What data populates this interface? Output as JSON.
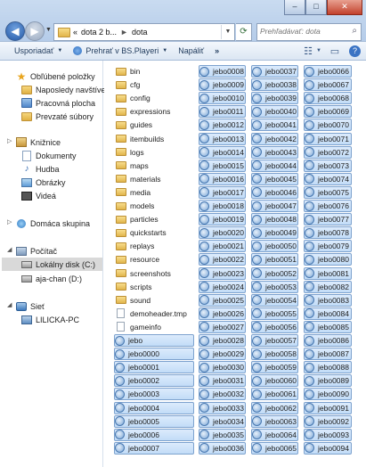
{
  "window": {
    "minimize": "–",
    "maximize": "□",
    "close": "✕"
  },
  "address": {
    "overflow": "«",
    "path_parent": "dota 2 b...",
    "separator": "►",
    "path_current": "dota"
  },
  "search": {
    "placeholder": "Prehľadávať: dota"
  },
  "toolbar": {
    "organize": "Usporiadať",
    "play": "Prehrať v BS.Playeri",
    "burn": "Napáliť",
    "more": "»"
  },
  "nav": {
    "favorites": "Obľúbené položky",
    "recent": "Naposledy navštívené",
    "desktop": "Pracovná plocha",
    "downloads": "Prevzaté súbory",
    "libraries": "Knižnice",
    "documents": "Dokumenty",
    "music": "Hudba",
    "pictures": "Obrázky",
    "videos": "Videá",
    "homegroup": "Domáca skupina",
    "computer": "Počítač",
    "local_disk": "Lokálny disk (C:)",
    "second_disk": "aja-chan (D:)",
    "network": "Sieť",
    "network_pc": "LILICKA-PC"
  },
  "files": {
    "col1": [
      {
        "name": "bin",
        "type": "folder"
      },
      {
        "name": "cfg",
        "type": "folder"
      },
      {
        "name": "config",
        "type": "folder"
      },
      {
        "name": "expressions",
        "type": "folder"
      },
      {
        "name": "guides",
        "type": "folder"
      },
      {
        "name": "itembuilds",
        "type": "folder"
      },
      {
        "name": "logs",
        "type": "folder"
      },
      {
        "name": "maps",
        "type": "folder"
      },
      {
        "name": "materials",
        "type": "folder"
      },
      {
        "name": "media",
        "type": "folder"
      },
      {
        "name": "models",
        "type": "folder"
      },
      {
        "name": "particles",
        "type": "folder"
      },
      {
        "name": "quickstarts",
        "type": "folder"
      },
      {
        "name": "replays",
        "type": "folder"
      },
      {
        "name": "resource",
        "type": "folder"
      },
      {
        "name": "screenshots",
        "type": "folder"
      },
      {
        "name": "scripts",
        "type": "folder"
      },
      {
        "name": "sound",
        "type": "folder"
      },
      {
        "name": "demoheader.tmp",
        "type": "file"
      },
      {
        "name": "gameinfo",
        "type": "file"
      },
      {
        "name": "jebo",
        "type": "dem"
      },
      {
        "name": "jebo0000",
        "type": "dem"
      },
      {
        "name": "jebo0001",
        "type": "dem"
      },
      {
        "name": "jebo0002",
        "type": "dem"
      },
      {
        "name": "jebo0003",
        "type": "dem"
      },
      {
        "name": "jebo0004",
        "type": "dem"
      },
      {
        "name": "jebo0005",
        "type": "dem"
      },
      {
        "name": "jebo0006",
        "type": "dem"
      },
      {
        "name": "jebo0007",
        "type": "dem"
      }
    ],
    "col2": [
      "jebo0008",
      "jebo0009",
      "jebo0010",
      "jebo0011",
      "jebo0012",
      "jebo0013",
      "jebo0014",
      "jebo0015",
      "jebo0016",
      "jebo0017",
      "jebo0018",
      "jebo0019",
      "jebo0020",
      "jebo0021",
      "jebo0022",
      "jebo0023",
      "jebo0024",
      "jebo0025",
      "jebo0026",
      "jebo0027",
      "jebo0028",
      "jebo0029",
      "jebo0030",
      "jebo0031",
      "jebo0032",
      "jebo0033",
      "jebo0034",
      "jebo0035",
      "jebo0036"
    ],
    "col3": [
      "jebo0037",
      "jebo0038",
      "jebo0039",
      "jebo0040",
      "jebo0041",
      "jebo0042",
      "jebo0043",
      "jebo0044",
      "jebo0045",
      "jebo0046",
      "jebo0047",
      "jebo0048",
      "jebo0049",
      "jebo0050",
      "jebo0051",
      "jebo0052",
      "jebo0053",
      "jebo0054",
      "jebo0055",
      "jebo0056",
      "jebo0057",
      "jebo0058",
      "jebo0059",
      "jebo0060",
      "jebo0061",
      "jebo0062",
      "jebo0063",
      "jebo0064",
      "jebo0065"
    ],
    "col4": [
      "jebo0066",
      "jebo0067",
      "jebo0068",
      "jebo0069",
      "jebo0070",
      "jebo0071",
      "jebo0072",
      "jebo0073",
      "jebo0074",
      "jebo0075",
      "jebo0076",
      "jebo0077",
      "jebo0078",
      "jebo0079",
      "jebo0080",
      "jebo0081",
      "jebo0082",
      "jebo0083",
      "jebo0084",
      "jebo0085",
      "jebo0086",
      "jebo0087",
      "jebo0088",
      "jebo0089",
      "jebo0090",
      "jebo0091",
      "jebo0092",
      "jebo0093",
      "jebo0094"
    ]
  }
}
